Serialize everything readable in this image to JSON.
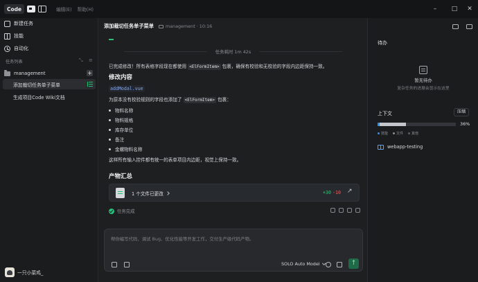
{
  "titlebar": {
    "app_name": "Code",
    "menu": [
      "编辑(E)",
      "帮助(H)"
    ],
    "controls": [
      "minimize-icon",
      "maximize-icon",
      "close-icon"
    ]
  },
  "sidebar": {
    "items": [
      {
        "label": "新建任务",
        "icon": "edit-icon"
      },
      {
        "label": "技能",
        "icon": "grid-icon"
      },
      {
        "label": "自动化",
        "icon": "clock-icon"
      }
    ],
    "section_label": "任务列表",
    "folder": "management",
    "tasks": [
      {
        "label": "添加裁切任务单子菜单",
        "active": true
      },
      {
        "label": "生成项目Code Wiki文档",
        "active": false
      }
    ],
    "user_name": "一只小菜鸡_"
  },
  "main": {
    "title": "添加裁切任务单子菜单",
    "subtitle": "management · 10:16",
    "timer": "任务耗时 1m 42s",
    "intro_pre": "已完成修改！所有表格字段现在都使用 ",
    "intro_code": "<ElFormItem>",
    "intro_post": " 包裹，确保有校验和无校验的字段内边距保持一致。",
    "section1": "修改内容",
    "file": "addModal.vue",
    "desc_pre": "为原本没有校验规则的字段也添加了 ",
    "desc_code": "<ElFormItem>",
    "desc_post": " 包裹：",
    "fields": [
      "物料名称",
      "物料规格",
      "库存单位",
      "备注",
      "金螺物料名称"
    ],
    "summary": "这样所有输入控件都有统一的表单项目内边距，视觉上保持一致。",
    "section2": "产物汇总",
    "changes_label": "1 个文件已更改",
    "added": "+30",
    "removed": "-10",
    "status": "任务完成",
    "composer_placeholder": "帮你编写代码、调试 Bug、优化性能等开发工作，交付生产级代码产物。",
    "model": "SOLO Auto Model"
  },
  "right": {
    "todo_title": "待办",
    "empty_title": "暂无待办",
    "empty_sub": "复杂任务的进展会显示在这里",
    "context_label": "上下文",
    "compress_label": "压缩",
    "context_percent": "36%",
    "context_fraction": 0.36,
    "legend": [
      {
        "label": "技能",
        "color": "#2d8ff0"
      },
      {
        "label": "文件",
        "color": "#8d9095"
      },
      {
        "label": "其他",
        "color": "#8d9095"
      }
    ],
    "skill_item": "webapp-testing"
  }
}
